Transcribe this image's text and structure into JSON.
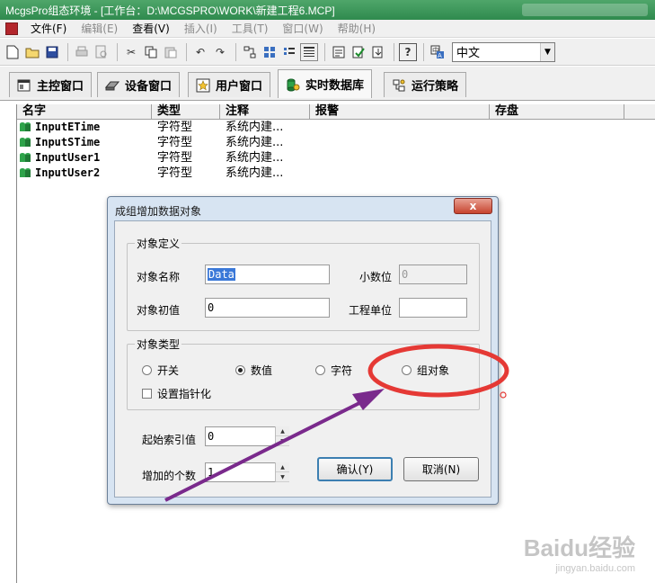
{
  "window": {
    "title": "McgsPro组态环境 - [工作台：D:\\MCGSPRO\\WORK\\新建工程6.MCP]"
  },
  "menu": [
    {
      "label": "文件(F)",
      "disabled": false
    },
    {
      "label": "编辑(E)",
      "disabled": true
    },
    {
      "label": "查看(V)",
      "disabled": false
    },
    {
      "label": "插入(I)",
      "disabled": true
    },
    {
      "label": "工具(T)",
      "disabled": true
    },
    {
      "label": "窗口(W)",
      "disabled": true
    },
    {
      "label": "帮助(H)",
      "disabled": true
    }
  ],
  "toolbar": {
    "language": "中文"
  },
  "tabs": [
    {
      "label": "主控窗口",
      "icon": "main-control-icon"
    },
    {
      "label": "设备窗口",
      "icon": "device-icon"
    },
    {
      "label": "用户窗口",
      "icon": "user-window-icon"
    },
    {
      "label": "实时数据库",
      "icon": "database-icon",
      "active": true
    },
    {
      "label": "运行策略",
      "icon": "strategy-icon"
    }
  ],
  "table": {
    "columns": [
      "名字",
      "类型",
      "注释",
      "报警",
      "存盘"
    ],
    "rows": [
      {
        "name": "InputETime",
        "type": "字符型",
        "comment": "系统内建..."
      },
      {
        "name": "InputSTime",
        "type": "字符型",
        "comment": "系统内建..."
      },
      {
        "name": "InputUser1",
        "type": "字符型",
        "comment": "系统内建..."
      },
      {
        "name": "InputUser2",
        "type": "字符型",
        "comment": "系统内建..."
      }
    ]
  },
  "dialog": {
    "title": "成组增加数据对象",
    "close_label": "x",
    "definition": {
      "legend": "对象定义",
      "name_label": "对象名称",
      "name_value": "Data",
      "decimals_label": "小数位",
      "decimals_value": "0",
      "initial_label": "对象初值",
      "initial_value": "0",
      "unit_label": "工程单位",
      "unit_value": ""
    },
    "type_group": {
      "legend": "对象类型",
      "options": [
        {
          "label": "开关",
          "selected": false
        },
        {
          "label": "数值",
          "selected": true
        },
        {
          "label": "字符",
          "selected": false
        },
        {
          "label": "组对象",
          "selected": false
        }
      ],
      "pointer_label": "设置指针化"
    },
    "start_index_label": "起始索引值",
    "start_index_value": "0",
    "count_label": "增加的个数",
    "count_value": "1",
    "ok_label": "确认(Y)",
    "cancel_label": "取消(N)"
  },
  "annotation": {
    "ring_color": "#e53935",
    "arrow_color": "#7a2a8c"
  },
  "watermark": {
    "line1": "Baidu经验",
    "line2": "jingyan.baidu.com"
  }
}
